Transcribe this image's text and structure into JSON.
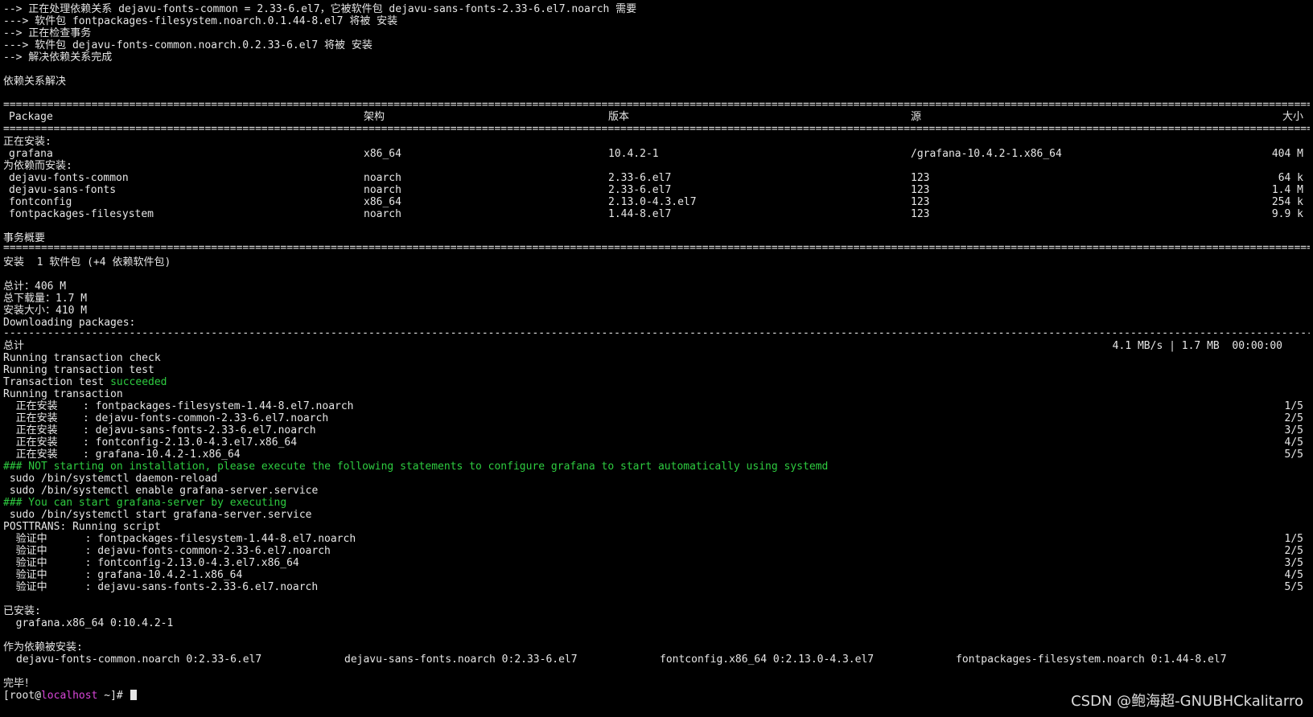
{
  "intro": [
    "--> 正在处理依赖关系 dejavu-fonts-common = 2.33-6.el7，它被软件包 dejavu-sans-fonts-2.33-6.el7.noarch 需要",
    "---> 软件包 fontpackages-filesystem.noarch.0.1.44-8.el7 将被 安装",
    "--> 正在检查事务",
    "---> 软件包 dejavu-fonts-common.noarch.0.2.33-6.el7 将被 安装",
    "--> 解决依赖关系完成"
  ],
  "deps_resolved": "依赖关系解决",
  "table": {
    "headers": {
      "package": "Package",
      "arch": "架构",
      "version": "版本",
      "repo": "源",
      "size": "大小"
    },
    "installing_label": "正在安装:",
    "installing": [
      {
        "package": "grafana",
        "arch": "x86_64",
        "version": "10.4.2-1",
        "repo": "/grafana-10.4.2-1.x86_64",
        "size": "404 M"
      }
    ],
    "deps_label": "为依赖而安装:",
    "deps": [
      {
        "package": "dejavu-fonts-common",
        "arch": "noarch",
        "version": "2.33-6.el7",
        "repo": "123",
        "size": "64 k"
      },
      {
        "package": "dejavu-sans-fonts",
        "arch": "noarch",
        "version": "2.33-6.el7",
        "repo": "123",
        "size": "1.4 M"
      },
      {
        "package": "fontconfig",
        "arch": "x86_64",
        "version": "2.13.0-4.3.el7",
        "repo": "123",
        "size": "254 k"
      },
      {
        "package": "fontpackages-filesystem",
        "arch": "noarch",
        "version": "1.44-8.el7",
        "repo": "123",
        "size": "9.9 k"
      }
    ]
  },
  "summary_title": "事务概要",
  "summary_install": "安装  1 软件包 (+4 依赖软件包)",
  "totals": [
    "总计：406 M",
    "总下载量：1.7 M",
    "安装大小：410 M"
  ],
  "downloading": "Downloading packages:",
  "total_left": "总计",
  "total_right": "4.1 MB/s | 1.7 MB  00:00:00",
  "run_lines": [
    "Running transaction check",
    "Running transaction test"
  ],
  "test_prefix": "Transaction test ",
  "test_status": "succeeded",
  "run_tx": "Running transaction",
  "install_steps": [
    {
      "label": "  正在安装    : fontpackages-filesystem-1.44-8.el7.noarch",
      "count": "1/5"
    },
    {
      "label": "  正在安装    : dejavu-fonts-common-2.33-6.el7.noarch",
      "count": "2/5"
    },
    {
      "label": "  正在安装    : dejavu-sans-fonts-2.33-6.el7.noarch",
      "count": "3/5"
    },
    {
      "label": "  正在安装    : fontconfig-2.13.0-4.3.el7.x86_64",
      "count": "4/5"
    },
    {
      "label": "  正在安装    : grafana-10.4.2-1.x86_64",
      "count": "5/5"
    }
  ],
  "notice1": "### NOT starting on installation, please execute the following statements to configure grafana to start automatically using systemd",
  "cmd1": " sudo /bin/systemctl daemon-reload",
  "cmd2": " sudo /bin/systemctl enable grafana-server.service",
  "notice2": "### You can start grafana-server by executing",
  "cmd3": " sudo /bin/systemctl start grafana-server.service",
  "posttrans": "POSTTRANS: Running script",
  "verify_steps": [
    {
      "label": "  验证中      : fontpackages-filesystem-1.44-8.el7.noarch",
      "count": "1/5"
    },
    {
      "label": "  验证中      : dejavu-fonts-common-2.33-6.el7.noarch",
      "count": "2/5"
    },
    {
      "label": "  验证中      : fontconfig-2.13.0-4.3.el7.x86_64",
      "count": "3/5"
    },
    {
      "label": "  验证中      : grafana-10.4.2-1.x86_64",
      "count": "4/5"
    },
    {
      "label": "  验证中      : dejavu-sans-fonts-2.33-6.el7.noarch",
      "count": "5/5"
    }
  ],
  "installed_label": "已安装:",
  "installed_pkg": "  grafana.x86_64 0:10.4.2-1",
  "dep_installed_label": "作为依赖被安装:",
  "dep_installed": [
    "dejavu-fonts-common.noarch 0:2.33-6.el7",
    "dejavu-sans-fonts.noarch 0:2.33-6.el7",
    "fontconfig.x86_64 0:2.13.0-4.3.el7",
    "fontpackages-filesystem.noarch 0:1.44-8.el7"
  ],
  "complete": "完毕！",
  "prompt": {
    "open": "[root@",
    "host": "localhost",
    "rest": " ~]# "
  },
  "watermark": "CSDN @鲍海超-GNUBHCkalitarro"
}
